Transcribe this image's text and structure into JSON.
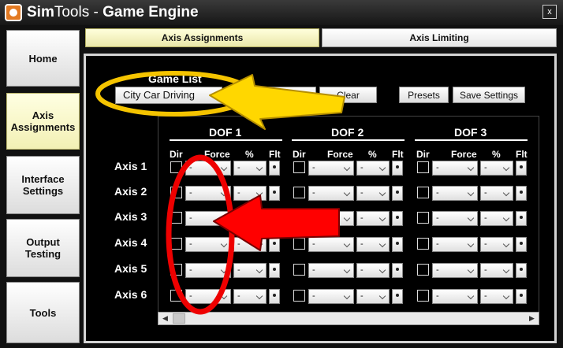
{
  "window": {
    "title_part1": "Sim",
    "title_part2": "Tools - ",
    "title_part3": "Game Engine",
    "close_label": "x"
  },
  "sidebar": {
    "items": [
      {
        "label": "Home",
        "active": false
      },
      {
        "label": "Axis Assignments",
        "active": true
      },
      {
        "label": "Interface Settings",
        "active": false
      },
      {
        "label": "Output Testing",
        "active": false
      },
      {
        "label": "Tools",
        "active": false
      }
    ]
  },
  "tabs": [
    {
      "label": "Axis Assignments",
      "active": true
    },
    {
      "label": "Axis Limiting",
      "active": false
    }
  ],
  "toolbar": {
    "game_list_label": "Game List",
    "game_selected": "City Car Driving",
    "default_label": "Default",
    "clear_label": "Clear",
    "presets_label": "Presets",
    "save_label": "Save Settings"
  },
  "grid": {
    "dofs": [
      "DOF 1",
      "DOF 2",
      "DOF 3"
    ],
    "col_headers": {
      "dir": "Dir",
      "force": "Force",
      "percent": "%",
      "flt": "Flt"
    },
    "axes": [
      "Axis 1",
      "Axis 2",
      "Axis 3",
      "Axis 4",
      "Axis 5",
      "Axis 6"
    ],
    "cell_value": "-"
  },
  "colors": {
    "annotation_yellow": "#f5c400",
    "annotation_red": "#ee0000"
  }
}
